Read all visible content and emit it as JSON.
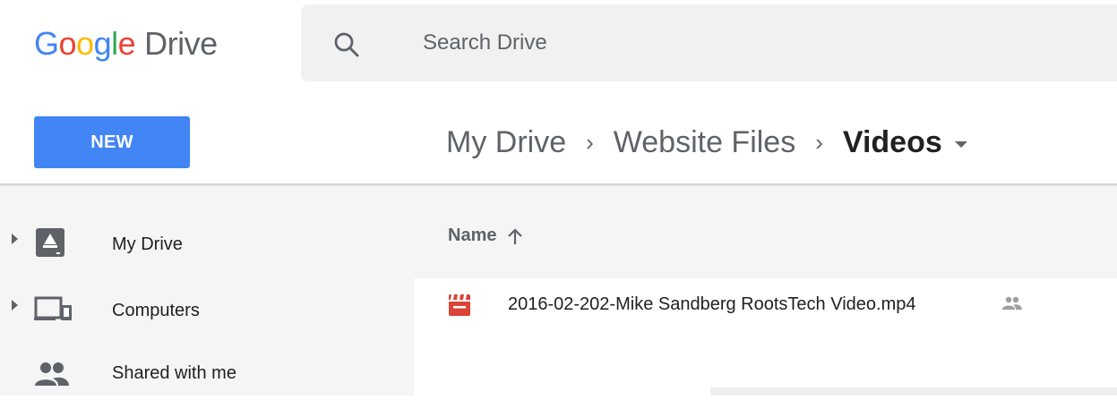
{
  "header": {
    "logo": {
      "letters": [
        "G",
        "o",
        "o",
        "g",
        "l",
        "e"
      ],
      "product": "Drive"
    },
    "search": {
      "placeholder": "Search Drive",
      "value": ""
    },
    "new_button": "NEW",
    "breadcrumb": [
      {
        "label": "My Drive"
      },
      {
        "label": "Website Files"
      },
      {
        "label": "Videos",
        "current": true
      }
    ]
  },
  "sidebar": {
    "items": [
      {
        "label": "My Drive",
        "icon": "drive-icon",
        "expandable": true
      },
      {
        "label": "Computers",
        "icon": "computers-icon",
        "expandable": true
      },
      {
        "label": "Shared with me",
        "icon": "shared-with-me-icon",
        "expandable": false
      }
    ]
  },
  "file_list": {
    "column_header": "Name",
    "sort": "ascending",
    "files": [
      {
        "name": "2016-02-202-Mike Sandberg RootsTech Video.mp4",
        "type": "video",
        "shared": true
      }
    ]
  },
  "colors": {
    "accent": "#4285f4",
    "video_icon": "#db4437",
    "sidebar_bg": "#f5f5f5"
  }
}
